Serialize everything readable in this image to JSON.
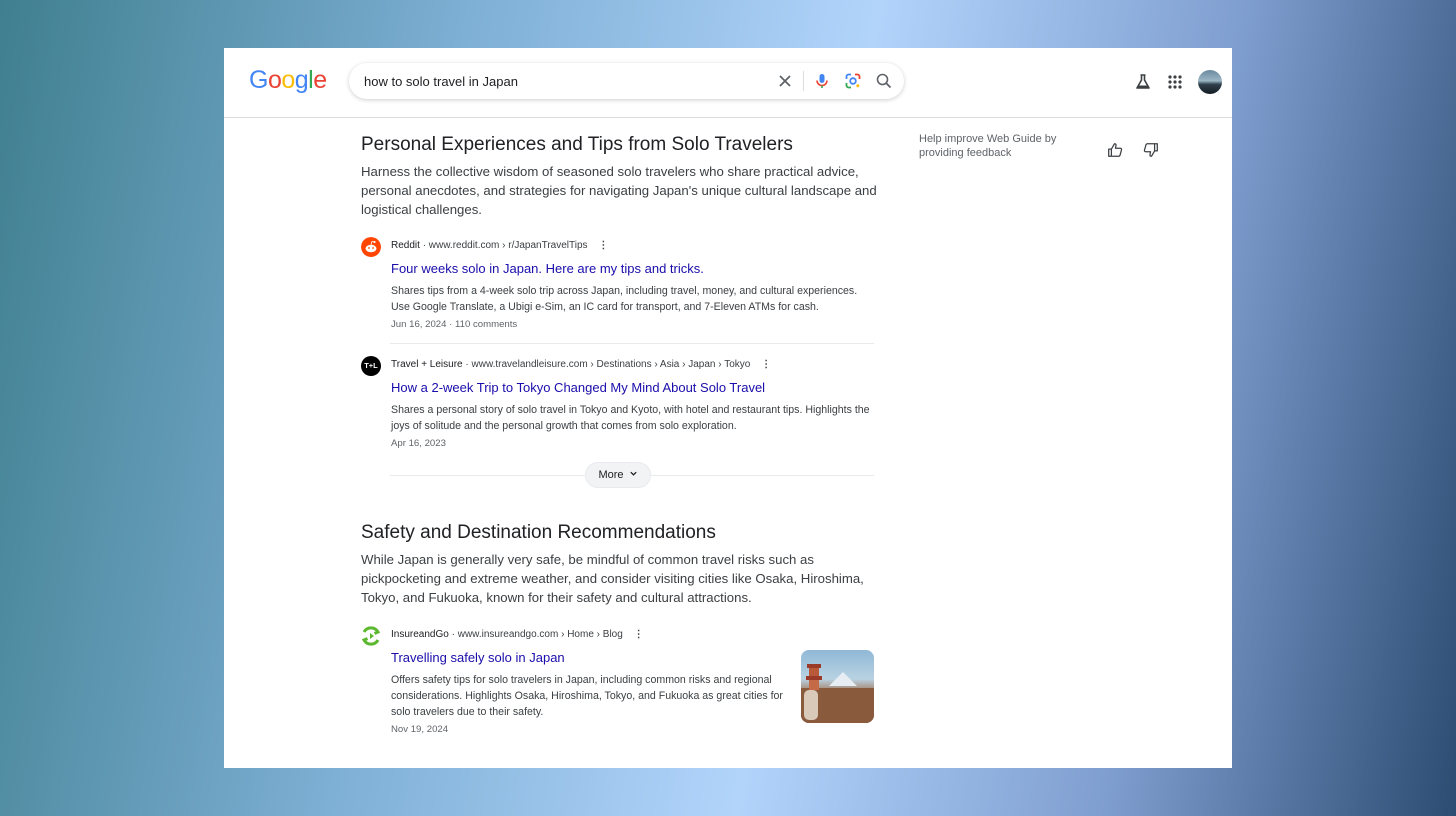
{
  "header": {
    "logo_text": "Google",
    "search": {
      "query": "how to solo travel in Japan"
    }
  },
  "feedback": {
    "text": "Help improve Web Guide by providing feedback"
  },
  "sections": [
    {
      "heading": "Personal Experiences and Tips from Solo Travelers",
      "description": "Harness the collective wisdom of seasoned solo travelers who share practical advice, personal anecdotes, and strategies for navigating Japan's unique cultural landscape and logistical challenges.",
      "results": [
        {
          "site": "Reddit",
          "breadcrumb": "· www.reddit.com › r/JapanTravelTips",
          "title": "Four weeks solo in Japan. Here are my tips and tricks.",
          "snippet": "Shares tips from a 4-week solo trip across Japan, including travel, money, and cultural experiences. Use Google Translate, a Ubigi e-Sim, an IC card for transport, and 7-Eleven ATMs for cash.",
          "meta": "Jun 16, 2024 · 110 comments",
          "favicon_color": "#ff4500"
        },
        {
          "site": "Travel + Leisure",
          "breadcrumb": "· www.travelandleisure.com › Destinations › Asia › Japan › Tokyo",
          "title": "How a 2-week Trip to Tokyo Changed My Mind About Solo Travel",
          "snippet": "Shares a personal story of solo travel in Tokyo and Kyoto, with hotel and restaurant tips. Highlights the joys of solitude and the personal growth that comes from solo exploration.",
          "meta": "Apr 16, 2023",
          "favicon_text": "T+L",
          "favicon_color": "#000000"
        }
      ],
      "more_label": "More"
    },
    {
      "heading": "Safety and Destination Recommendations",
      "description": "While Japan is generally very safe, be mindful of common travel risks such as pickpocketing and extreme weather, and consider visiting cities like Osaka, Hiroshima, Tokyo, and Fukuoka, known for their safety and cultural attractions.",
      "results": [
        {
          "site": "InsureandGo",
          "breadcrumb": "· www.insureandgo.com › Home › Blog",
          "title": "Travelling safely solo in Japan",
          "snippet": "Offers safety tips for solo travelers in Japan, including common risks and regional considerations. Highlights Osaka, Hiroshima, Tokyo, and Fukuoka as great cities for solo travelers due to their safety.",
          "meta": "Nov 19, 2024",
          "favicon_color": "#5cb82e"
        }
      ]
    }
  ],
  "colors": {
    "link": "#1a0dab",
    "text": "#202124"
  }
}
